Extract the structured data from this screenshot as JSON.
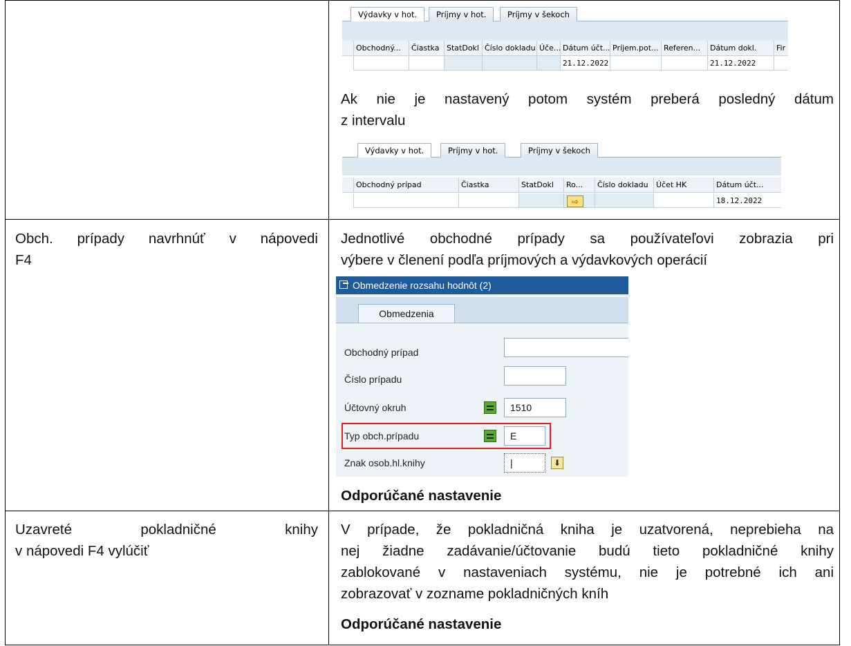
{
  "sap_grid_1": {
    "tabs": [
      "Výdavky v hot.",
      "Príjmy v hot.",
      "Príjmy v šekoch"
    ],
    "columns": [
      "Obchodný...",
      "Čiastka",
      "StatDokl",
      "Číslo dokladu",
      "Úče...",
      "Dátum účt...",
      "Príjem.pot...",
      "Referen...",
      "Dátum dokl.",
      "Fir"
    ],
    "row": {
      "posting_date": "21.12.2022",
      "doc_date": "21.12.2022"
    }
  },
  "row1_text": {
    "line1": "Ak nie je nastavený potom systém preberá posledný dátum",
    "line2": "z intervalu"
  },
  "sap_grid_2": {
    "tabs": [
      "Výdavky v hot.",
      "Príjmy v hot.",
      "Príjmy v šekoch"
    ],
    "columns": [
      "Obchodný prípad",
      "Čiastka",
      "StatDokl",
      "Ro...",
      "Číslo dokladu",
      "Účet HK",
      "Dátum účt..."
    ],
    "row": {
      "posting_date": "18.12.2022"
    }
  },
  "row2": {
    "left_line1": "Obch. prípady navrhnúť v nápovedi",
    "left_line2": "F4",
    "right_line1": "Jednotlivé obchodné prípady sa používateľovi zobrazia pri",
    "right_line2": "výbere v členení podľa príjmových a výdavkových operácií",
    "recommended": "Odporúčané nastavenie"
  },
  "dialog": {
    "title": "Obmedzenie rozsahu hodnôt (2)",
    "tab": "Obmedzenia",
    "fields": {
      "business_case": {
        "label": "Obchodný prípad",
        "value": ""
      },
      "case_number": {
        "label": "Číslo prípadu",
        "value": ""
      },
      "company_code": {
        "label": "Účtovný okruh",
        "value": "1510"
      },
      "case_type": {
        "label": "Typ obch.prípadu",
        "value": "E"
      },
      "gl_indicator": {
        "label": "Znak osob.hl.knihy",
        "value": "|"
      }
    }
  },
  "row3": {
    "left_line1_a": "Uzavreté",
    "left_line1_b": "pokladničné",
    "left_line1_c": "knihy",
    "left_line2": "v nápovedi F4 vylúčiť",
    "right_line1": "V prípade, že pokladničná kniha je uzatvorená, neprebieha na",
    "right_line2": "nej žiadne zadávanie/účtovanie budú tieto pokladničné knihy",
    "right_line3": "zablokované v nastaveniach systému, nie je potrebné ich ani",
    "right_line4": "zobrazovať v zozname pokladničných kníh",
    "recommended": "Odporúčané nastavenie"
  }
}
